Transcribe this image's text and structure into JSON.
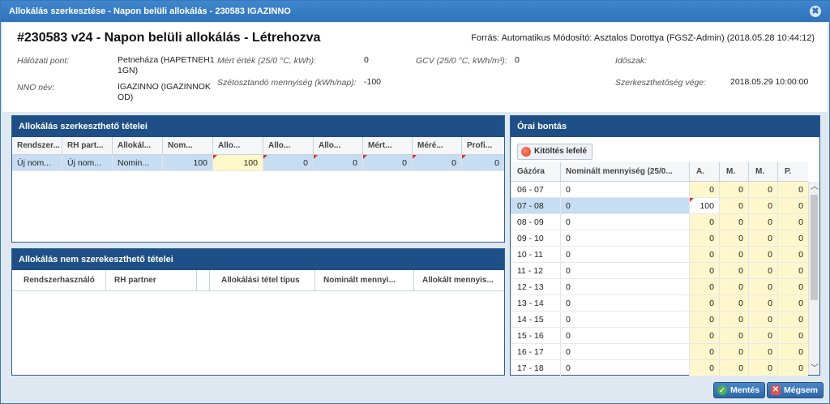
{
  "window": {
    "title": "Allokálás szerkesztése - Napon belüli allokálás - 230583 IGAZINNO",
    "close_glyph": "✖"
  },
  "header": {
    "title": "#230583 v24 - Napon belüli allokálás - Létrehozva",
    "source": "Forrás: Automatikus Módosító: Asztalos Dorottya (FGSZ-Admin) (2018.05.28 10:44:12)",
    "fields": {
      "halozati_pont_label": "Hálózati pont:",
      "halozati_pont_value": "Petneháza (HAPETNEH11GN)",
      "nno_nev_label": "NNO név:",
      "nno_nev_value": "IGAZINNO (IGAZINNOKOD)",
      "mert_ertek_label": "Mért érték (25/0 °C, kWh):",
      "mert_ertek_value": "0",
      "szetosztando_label": "Szétosztandó mennyiség (kWh/nap):",
      "szetosztando_value": "-100",
      "gcv_label": "GCV (25/0 °C, kWh/m³):",
      "gcv_value": "0",
      "idoszak_label": "Időszak:",
      "idoszak_value": "",
      "szerk_vege_label": "Szerkeszthetőség vége:",
      "szerk_vege_value": "2018.05.29 10:00:00"
    }
  },
  "editable_panel": {
    "title": "Allokálás szerkeszthető tételei",
    "columns": [
      "Rendszer...",
      "RH part...",
      "Allokál...",
      "Nom...",
      "Allo...",
      "Allo...",
      "Allo...",
      "Mért...",
      "Méré...",
      "Profi..."
    ],
    "rows": [
      [
        "Új nom...",
        "Új nom...",
        "Nomin...",
        "100",
        "100",
        "0",
        "0",
        "0",
        "0",
        "0"
      ]
    ]
  },
  "noneditable_panel": {
    "title": "Allokálás nem szerekeszthető tételei",
    "columns": [
      "Rendszerhasználó",
      "RH partner",
      "",
      "Allokálási tétel típus",
      "Nominált mennyi...",
      "Allokált mennyis..."
    ]
  },
  "hourly_panel": {
    "title": "Órai bontás",
    "fill_button": "Kitöltés lefelé",
    "columns": [
      "Gázóra",
      "Nominált mennyiség (25/0...",
      "A.",
      "M.",
      "M.",
      "P."
    ],
    "rows": [
      [
        "06 - 07",
        "0",
        "0",
        "0",
        "0",
        "0"
      ],
      [
        "07 - 08",
        "0",
        "100",
        "0",
        "0",
        "0"
      ],
      [
        "08 - 09",
        "0",
        "0",
        "0",
        "0",
        "0"
      ],
      [
        "09 - 10",
        "0",
        "0",
        "0",
        "0",
        "0"
      ],
      [
        "10 - 11",
        "0",
        "0",
        "0",
        "0",
        "0"
      ],
      [
        "11 - 12",
        "0",
        "0",
        "0",
        "0",
        "0"
      ],
      [
        "12 - 13",
        "0",
        "0",
        "0",
        "0",
        "0"
      ],
      [
        "13 - 14",
        "0",
        "0",
        "0",
        "0",
        "0"
      ],
      [
        "14 - 15",
        "0",
        "0",
        "0",
        "0",
        "0"
      ],
      [
        "15 - 16",
        "0",
        "0",
        "0",
        "0",
        "0"
      ],
      [
        "16 - 17",
        "0",
        "0",
        "0",
        "0",
        "0"
      ],
      [
        "17 - 18",
        "0",
        "0",
        "0",
        "0",
        "0"
      ]
    ]
  },
  "footer": {
    "save_label": "Mentés",
    "cancel_label": "Mégsem"
  },
  "icons": {
    "close": "close-icon",
    "fill": "fill-down-icon",
    "save": "check-icon",
    "cancel": "cancel-icon"
  }
}
